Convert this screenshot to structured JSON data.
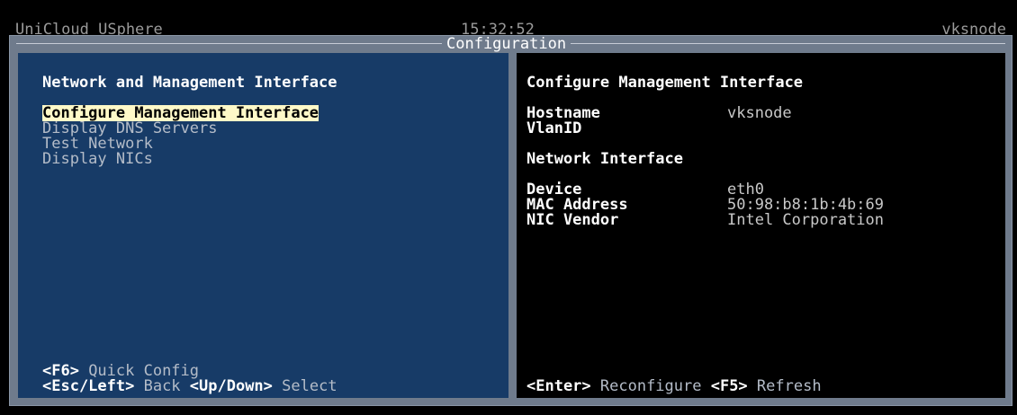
{
  "topbar": {
    "app_name": "UniCloud USphere",
    "time": "15:32:52",
    "hostname": "vksnode"
  },
  "frame": {
    "title": "Configuration"
  },
  "left": {
    "heading": "Network and Management Interface",
    "menu": [
      {
        "label": "Configure Management Interface",
        "selected": true
      },
      {
        "label": "Display DNS Servers",
        "selected": false
      },
      {
        "label": "Test Network",
        "selected": false
      },
      {
        "label": "Display NICs",
        "selected": false
      }
    ],
    "hints": {
      "line1_key": "<F6>",
      "line1_text": " Quick Config",
      "line2_key1": "<Esc/Left>",
      "line2_text1": " Back ",
      "line2_key2": "<Up/Down>",
      "line2_text2": " Select"
    }
  },
  "right": {
    "heading": "Configure Management Interface",
    "hostname_label": "Hostname",
    "hostname_value": "vksnode",
    "vlan_label": "VlanID",
    "vlan_value": "",
    "nic_heading": "Network Interface",
    "device_label": "Device",
    "device_value": "eth0",
    "mac_label": "MAC Address",
    "mac_value": "50:98:b8:1b:4b:69",
    "vendor_label": "NIC Vendor",
    "vendor_value": "Intel Corporation",
    "hints": {
      "key1": "<Enter>",
      "text1": " Reconfigure ",
      "key2": "<F5>",
      "text2": " Refresh"
    }
  },
  "colors": {
    "left_panel_bg": "#173b67",
    "right_panel_bg": "#000000",
    "frame_bg": "#6f7b8c",
    "selection_bg": "#fff9c8"
  }
}
